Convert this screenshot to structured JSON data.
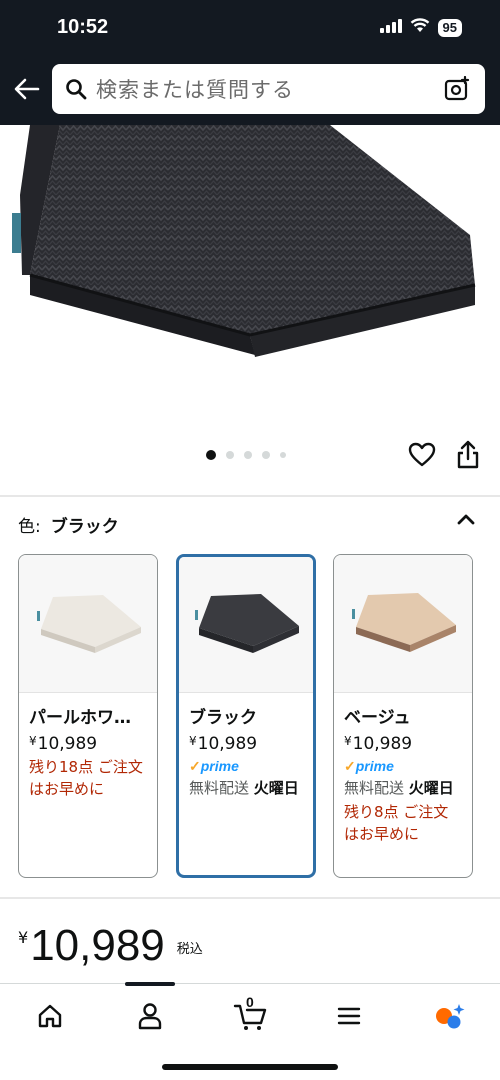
{
  "status": {
    "time": "10:52",
    "battery": "95",
    "icons": [
      "signal-icon",
      "wifi-icon",
      "battery-icon"
    ]
  },
  "header": {
    "search_placeholder": "検索または質問する",
    "icons": [
      "back-arrow-icon",
      "search-icon",
      "camera-icon"
    ]
  },
  "gallery": {
    "image_count": 5,
    "active_index": 0,
    "icons": [
      "heart-icon",
      "share-icon"
    ]
  },
  "color_section": {
    "label": "色:",
    "selected": "ブラック",
    "options": [
      {
        "name": "パールホワ…",
        "price": "10,989",
        "currency": "¥",
        "prime": false,
        "stock_note": "残り18点 ご注文はお早めに",
        "swatch_color": "#e9e4dc"
      },
      {
        "name": "ブラック",
        "price": "10,989",
        "currency": "¥",
        "prime": true,
        "prime_label": "prime",
        "shipping": "無料配送",
        "shipping_day": "火曜日",
        "swatch_color": "#3a3b40"
      },
      {
        "name": "ベージュ",
        "price": "10,989",
        "currency": "¥",
        "prime": true,
        "prime_label": "prime",
        "shipping": "無料配送",
        "shipping_day": "火曜日",
        "stock_note": "残り8点 ご注文はお早めに",
        "swatch_color": "#c9a88a"
      }
    ]
  },
  "price": {
    "currency": "¥",
    "amount": "10,989",
    "tax_note": "税込"
  },
  "bottom_nav": {
    "cart_count": "0",
    "items": [
      "home-icon",
      "account-icon",
      "cart-icon",
      "menu-icon",
      "rufus-icon"
    ]
  },
  "colors": {
    "header_bg": "#131921",
    "selected_border": "#2f6fa6",
    "warning_text": "#b12704",
    "prime_blue": "#1a98ff"
  }
}
